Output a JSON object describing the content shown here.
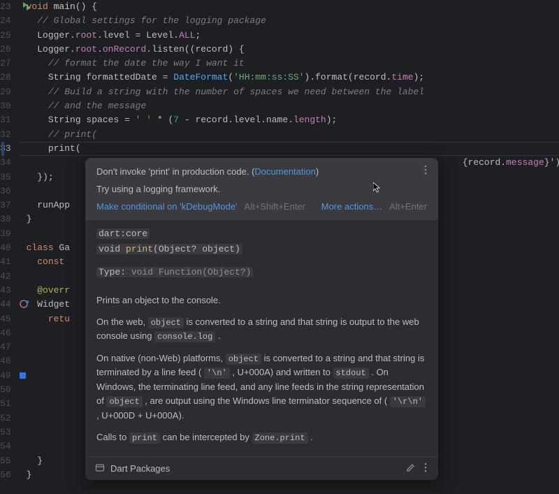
{
  "gutter": {
    "start": 23,
    "end": 56,
    "highlighted": 33
  },
  "code": {
    "23": {
      "indent": 0,
      "tokens": [
        [
          "kw",
          "void "
        ],
        [
          "fn",
          "main"
        ],
        [
          "ident",
          "() {"
        ]
      ]
    },
    "24": {
      "indent": 1,
      "tokens": [
        [
          "comment",
          "// Global settings for the logging package"
        ]
      ]
    },
    "25": {
      "indent": 1,
      "tokens": [
        [
          "ident",
          "Logger."
        ],
        [
          "field",
          "root"
        ],
        [
          "ident",
          ".level = Level."
        ],
        [
          "field",
          "ALL"
        ],
        [
          "ident",
          ";"
        ]
      ]
    },
    "26": {
      "indent": 1,
      "tokens": [
        [
          "ident",
          "Logger."
        ],
        [
          "field",
          "root"
        ],
        [
          "ident",
          "."
        ],
        [
          "field",
          "onRecord"
        ],
        [
          "ident",
          ".listen((record) {"
        ]
      ]
    },
    "27": {
      "indent": 2,
      "tokens": [
        [
          "comment",
          "// format the date the way I want it"
        ]
      ]
    },
    "28": {
      "indent": 2,
      "tokens": [
        [
          "ident",
          "String formattedDate = "
        ],
        [
          "call",
          "DateFormat"
        ],
        [
          "ident",
          "("
        ],
        [
          "str",
          "'HH:mm:ss:SS'"
        ],
        [
          "ident",
          ").format(record."
        ],
        [
          "field",
          "time"
        ],
        [
          "ident",
          ");"
        ]
      ]
    },
    "29": {
      "indent": 2,
      "tokens": [
        [
          "comment",
          "// Build a string with the number of spaces we need between the label"
        ]
      ]
    },
    "30": {
      "indent": 2,
      "tokens": [
        [
          "comment",
          "// and the message"
        ]
      ]
    },
    "31": {
      "indent": 2,
      "tokens": [
        [
          "ident",
          "String spaces = "
        ],
        [
          "str",
          "' '"
        ],
        [
          "ident",
          " * ("
        ],
        [
          "num",
          "7"
        ],
        [
          "ident",
          " - record.level.name."
        ],
        [
          "field",
          "length"
        ],
        [
          "ident",
          ");"
        ]
      ]
    },
    "32": {
      "indent": 2,
      "tokens": [
        [
          "comment",
          "// print("
        ]
      ]
    },
    "33": {
      "indent": 2,
      "tokens": [
        [
          "ident",
          "print("
        ]
      ]
    },
    "34": {
      "indent": 0,
      "tokens": [
        [
          "ident",
          "                                                                                {record."
        ],
        [
          "field",
          "message"
        ],
        [
          "ident",
          "}');"
        ]
      ]
    },
    "35": {
      "indent": 1,
      "tokens": [
        [
          "ident",
          "});"
        ]
      ]
    },
    "36": {
      "indent": 0,
      "tokens": [
        [
          "ident",
          ""
        ]
      ]
    },
    "37": {
      "indent": 1,
      "tokens": [
        [
          "ident",
          "runApp"
        ]
      ]
    },
    "38": {
      "indent": 0,
      "tokens": [
        [
          "ident",
          "}"
        ]
      ]
    },
    "39": {
      "indent": 0,
      "tokens": [
        [
          "ident",
          ""
        ]
      ]
    },
    "40": {
      "indent": 0,
      "tokens": [
        [
          "kw",
          "class "
        ],
        [
          "type",
          "Ga"
        ]
      ]
    },
    "41": {
      "indent": 1,
      "tokens": [
        [
          "kw",
          "const"
        ]
      ]
    },
    "42": {
      "indent": 0,
      "tokens": [
        [
          "ident",
          ""
        ]
      ]
    },
    "43": {
      "indent": 1,
      "tokens": [
        [
          "annot",
          "@overr"
        ]
      ]
    },
    "44": {
      "indent": 1,
      "tokens": [
        [
          "ident",
          "Widget"
        ]
      ]
    },
    "45": {
      "indent": 2,
      "tokens": [
        [
          "kw",
          "retu"
        ]
      ]
    },
    "46": {
      "indent": 0,
      "tokens": [
        [
          "ident",
          ""
        ]
      ]
    },
    "47": {
      "indent": 0,
      "tokens": [
        [
          "ident",
          ""
        ]
      ]
    },
    "48": {
      "indent": 0,
      "tokens": [
        [
          "ident",
          ""
        ]
      ]
    },
    "49": {
      "indent": 0,
      "tokens": [
        [
          "ident",
          ""
        ]
      ]
    },
    "50": {
      "indent": 0,
      "tokens": [
        [
          "ident",
          ""
        ]
      ]
    },
    "51": {
      "indent": 0,
      "tokens": [
        [
          "ident",
          ""
        ]
      ]
    },
    "52": {
      "indent": 0,
      "tokens": [
        [
          "ident",
          ""
        ]
      ]
    },
    "53": {
      "indent": 0,
      "tokens": [
        [
          "ident",
          ""
        ]
      ]
    },
    "54": {
      "indent": 0,
      "tokens": [
        [
          "ident",
          ""
        ]
      ]
    },
    "55": {
      "indent": 1,
      "tokens": [
        [
          "ident",
          "}"
        ]
      ]
    },
    "56": {
      "indent": 0,
      "tokens": [
        [
          "ident",
          "}"
        ]
      ]
    }
  },
  "tooltip": {
    "warning_pre": "Don't invoke 'print' in production code. (",
    "warning_link": "Documentation",
    "warning_post": ")",
    "try_hint": "Try using a logging framework.",
    "fix_label": "Make conditional on 'kDebugMode'",
    "fix_shortcut": "Alt+Shift+Enter",
    "more_label": "More actions…",
    "more_shortcut": "Alt+Enter",
    "sig_lib": "dart:core",
    "sig_decl_pre": "void ",
    "sig_decl_name": "print",
    "sig_decl_post": "(Object? object)",
    "sig_type_label": "Type: ",
    "sig_type_val": "void Function(Object?)",
    "doc_p1": "Prints an object to the console.",
    "doc_p2_a": "On the web, ",
    "doc_p2_b": " is converted to a string and that string is output to the web console using ",
    "doc_p2_c": " .",
    "doc_p3_a": "On native (non-Web) platforms, ",
    "doc_p3_b": " is converted to a string and that string is terminated by a line feed ( ",
    "doc_p3_c": " , U+000A) and written to ",
    "doc_p3_d": " . On Windows, the terminating line feed, and any line feeds in the string representation of ",
    "doc_p3_e": " , are output using the Windows line terminator sequence of ( ",
    "doc_p3_f": " , U+000D + U+000A).",
    "doc_p4_a": "Calls to ",
    "doc_p4_b": " can be intercepted by ",
    "doc_p4_c": " .",
    "code_object": "object",
    "code_consolelog": "console.log",
    "code_nl": "'\\n'",
    "code_stdout": "stdout",
    "code_crnl": "'\\r\\n'",
    "code_print": "print",
    "code_zoneprint": "Zone.print",
    "footer_label": "Dart Packages"
  }
}
